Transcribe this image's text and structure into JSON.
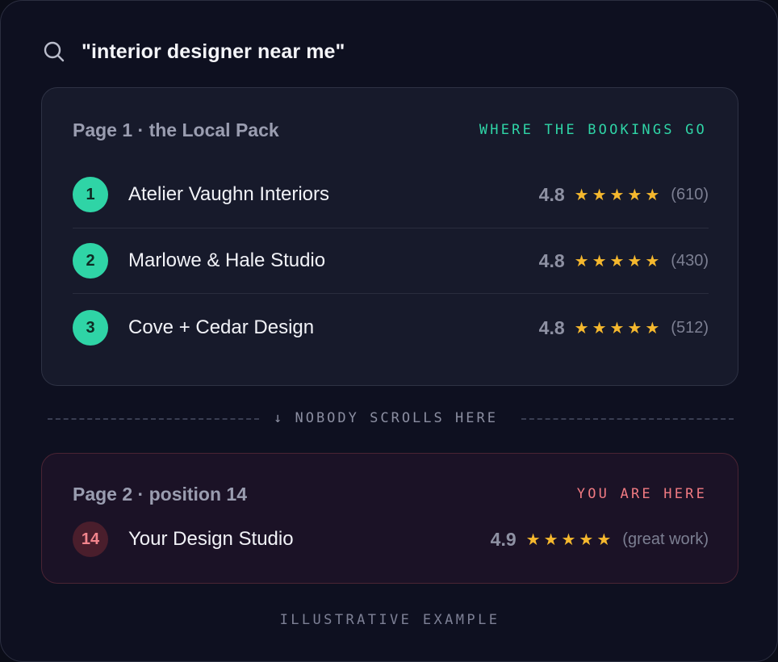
{
  "search": {
    "query": "\"interior designer near me\""
  },
  "local_pack": {
    "title": "Page 1 · the Local Pack",
    "tag": "WHERE THE BOOKINGS GO",
    "results": [
      {
        "rank": "1",
        "name": "Atelier Vaughn Interiors",
        "rating": "4.8",
        "stars": 5,
        "reviews": "(610)"
      },
      {
        "rank": "2",
        "name": "Marlowe & Hale Studio",
        "rating": "4.8",
        "stars": 5,
        "reviews": "(430)"
      },
      {
        "rank": "3",
        "name": "Cove + Cedar Design",
        "rating": "4.8",
        "stars": 5,
        "reviews": "(512)"
      }
    ]
  },
  "scroll_note": "↓ NOBODY SCROLLS HERE",
  "your_listing": {
    "title": "Page 2 · position 14",
    "tag": "YOU ARE HERE",
    "rank": "14",
    "name": "Your Design Studio",
    "rating": "4.9",
    "stars": 5,
    "reviews": "(great work)"
  },
  "footer_note": "ILLUSTRATIVE EXAMPLE",
  "colors": {
    "accent_green": "#2fd4a6",
    "accent_red": "#f07a82",
    "star": "#f5b82e"
  }
}
